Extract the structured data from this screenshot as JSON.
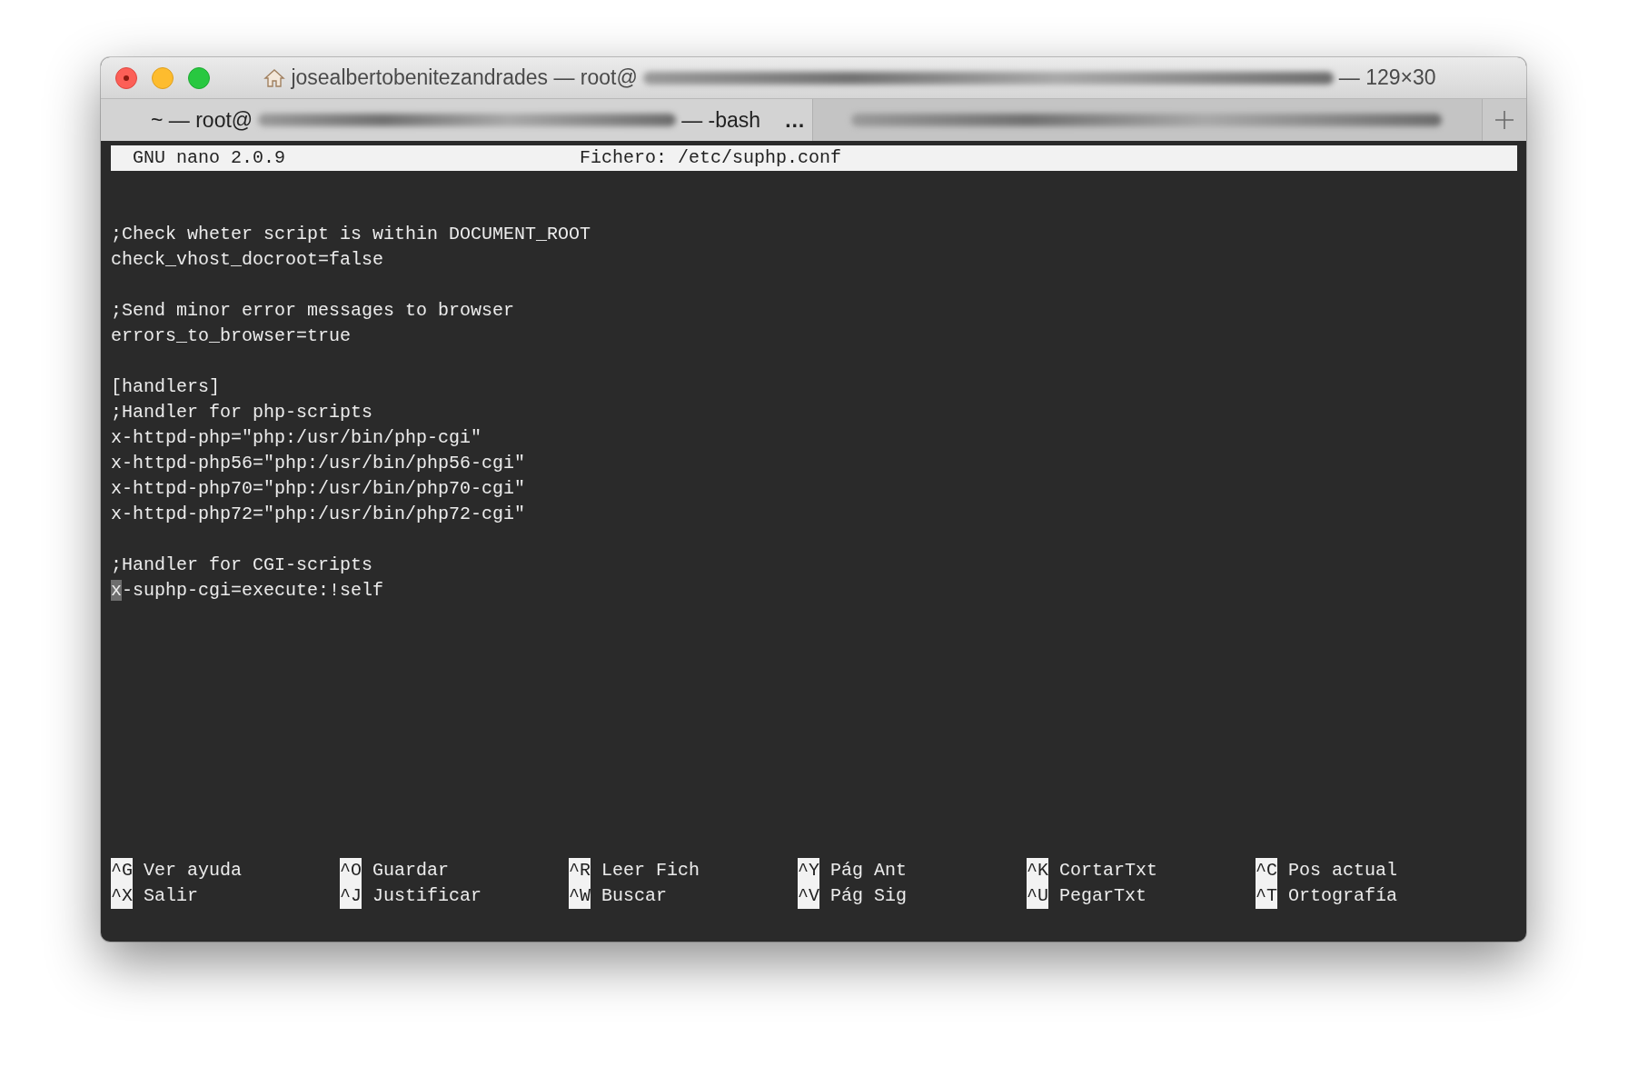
{
  "window": {
    "title_prefix": "josealbertobenitezandrades — root@",
    "title_suffix": "— 129×30"
  },
  "tabs": [
    {
      "prefix": "~ — root@",
      "suffix": "— -bash",
      "overflow": "…",
      "selected": true
    },
    {
      "selected": false
    }
  ],
  "nano": {
    "version": "GNU nano 2.0.9",
    "file": "Fichero: /etc/suphp.conf"
  },
  "lines": [
    {
      "kind": "blank"
    },
    {
      "kind": "blank"
    },
    {
      "kind": "text",
      "text": ";Check wheter script is within DOCUMENT_ROOT",
      "cursor": false
    },
    {
      "kind": "text",
      "text": "check_vhost_docroot=false",
      "cursor": false
    },
    {
      "kind": "blank"
    },
    {
      "kind": "text",
      "text": ";Send minor error messages to browser",
      "cursor": false
    },
    {
      "kind": "text",
      "text": "errors_to_browser=true",
      "cursor": false
    },
    {
      "kind": "blank"
    },
    {
      "kind": "text",
      "text": "[handlers]",
      "cursor": false
    },
    {
      "kind": "text",
      "text": ";Handler for php-scripts",
      "cursor": false
    },
    {
      "kind": "text",
      "text": "x-httpd-php=\"php:/usr/bin/php-cgi\"",
      "cursor": false
    },
    {
      "kind": "text",
      "text": "x-httpd-php56=\"php:/usr/bin/php56-cgi\"",
      "cursor": false
    },
    {
      "kind": "text",
      "text": "x-httpd-php70=\"php:/usr/bin/php70-cgi\"",
      "cursor": false
    },
    {
      "kind": "text",
      "text": "x-httpd-php72=\"php:/usr/bin/php72-cgi\"",
      "cursor": false
    },
    {
      "kind": "blank"
    },
    {
      "kind": "text",
      "text": ";Handler for CGI-scripts",
      "cursor": false
    },
    {
      "kind": "text",
      "text": "x-suphp-cgi=execute:!self",
      "cursor": true
    }
  ],
  "shortcuts": [
    [
      {
        "key": "^G",
        "label": "Ver ayuda"
      },
      {
        "key": "^O",
        "label": "Guardar"
      },
      {
        "key": "^R",
        "label": "Leer Fich"
      },
      {
        "key": "^Y",
        "label": "Pág Ant"
      },
      {
        "key": "^K",
        "label": "CortarTxt"
      },
      {
        "key": "^C",
        "label": "Pos actual"
      }
    ],
    [
      {
        "key": "^X",
        "label": "Salir"
      },
      {
        "key": "^J",
        "label": "Justificar"
      },
      {
        "key": "^W",
        "label": "Buscar"
      },
      {
        "key": "^V",
        "label": "Pág Sig"
      },
      {
        "key": "^U",
        "label": "PegarTxt"
      },
      {
        "key": "^T",
        "label": "Ortografía"
      }
    ]
  ]
}
